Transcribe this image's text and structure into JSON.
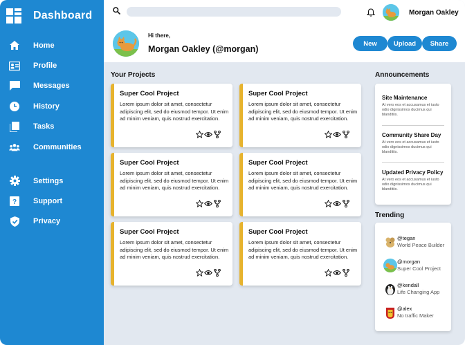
{
  "app": {
    "title": "Dashboard"
  },
  "sidebar": {
    "items": [
      {
        "label": "Home",
        "icon": "home-icon"
      },
      {
        "label": "Profile",
        "icon": "profile-card-icon"
      },
      {
        "label": "Messages",
        "icon": "message-icon"
      },
      {
        "label": "History",
        "icon": "clock-icon"
      },
      {
        "label": "Tasks",
        "icon": "tasks-icon"
      },
      {
        "label": "Communities",
        "icon": "people-icon"
      }
    ],
    "bottom_items": [
      {
        "label": "Settings",
        "icon": "gear-icon"
      },
      {
        "label": "Support",
        "icon": "help-icon"
      },
      {
        "label": "Privacy",
        "icon": "shield-icon"
      }
    ]
  },
  "topbar": {
    "search_placeholder": "",
    "user_name": "Morgan Oakley"
  },
  "header": {
    "greeting": "Hi there,",
    "full_name": "Morgan Oakley (@morgan)",
    "buttons": {
      "new": "New",
      "upload": "Upload",
      "share": "Share"
    }
  },
  "projects": {
    "title": "Your Projects",
    "cards": [
      {
        "title": "Super Cool Project",
        "body": "Lorem ipsum dolor sit amet, consectetur adipiscing elit, sed do eiusmod tempor. Ut enim ad minim veniam, quis nostrud exercitation."
      },
      {
        "title": "Super Cool Project",
        "body": "Lorem ipsum dolor sit amet, consectetur adipiscing elit, sed do eiusmod tempor. Ut enim ad minim veniam, quis nostrud exercitation."
      },
      {
        "title": "Super Cool Project",
        "body": "Lorem ipsum dolor sit amet, consectetur adipiscing elit, sed do eiusmod tempor. Ut enim ad minim veniam, quis nostrud exercitation."
      },
      {
        "title": "Super Cool Project",
        "body": "Lorem ipsum dolor sit amet, consectetur adipiscing elit, sed do eiusmod tempor. Ut enim ad minim veniam, quis nostrud exercitation."
      },
      {
        "title": "Super Cool Project",
        "body": "Lorem ipsum dolor sit amet, consectetur adipiscing elit, sed do eiusmod tempor. Ut enim ad minim veniam, quis nostrud exercitation."
      },
      {
        "title": "Super Cool Project",
        "body": "Lorem ipsum dolor sit amet, consectetur adipiscing elit, sed do eiusmod tempor. Ut enim ad minim veniam, quis nostrud exercitation."
      }
    ]
  },
  "announcements": {
    "title": "Announcements",
    "items": [
      {
        "title": "Site Maintenance",
        "text": "At vero eos et accusamus et iusto odio dignissimos ducimus qui blanditiis."
      },
      {
        "title": "Community Share Day",
        "text": "At vero eos et accusamus et iusto odio dignissimos ducimus qui blanditiis."
      },
      {
        "title": "Updated Privacy Policy",
        "text": "At vero eos et accusamus et iusto odio dignissimos ducimus qui blanditiis."
      }
    ]
  },
  "trending": {
    "title": "Trending",
    "items": [
      {
        "handle": "@tegan",
        "project": "World Peace Builder",
        "avatar": "dog-avatar"
      },
      {
        "handle": "@morgan",
        "project": "Super Cool Project",
        "avatar": "cat-avatar"
      },
      {
        "handle": "@kendall",
        "project": "Life Changing App",
        "avatar": "penguin-avatar"
      },
      {
        "handle": "@alex",
        "project": "No traffic Maker",
        "avatar": "ironman-avatar"
      }
    ]
  },
  "colors": {
    "primary": "#1e88d2",
    "accent": "#e7b32d",
    "background": "#e2e8f0"
  }
}
